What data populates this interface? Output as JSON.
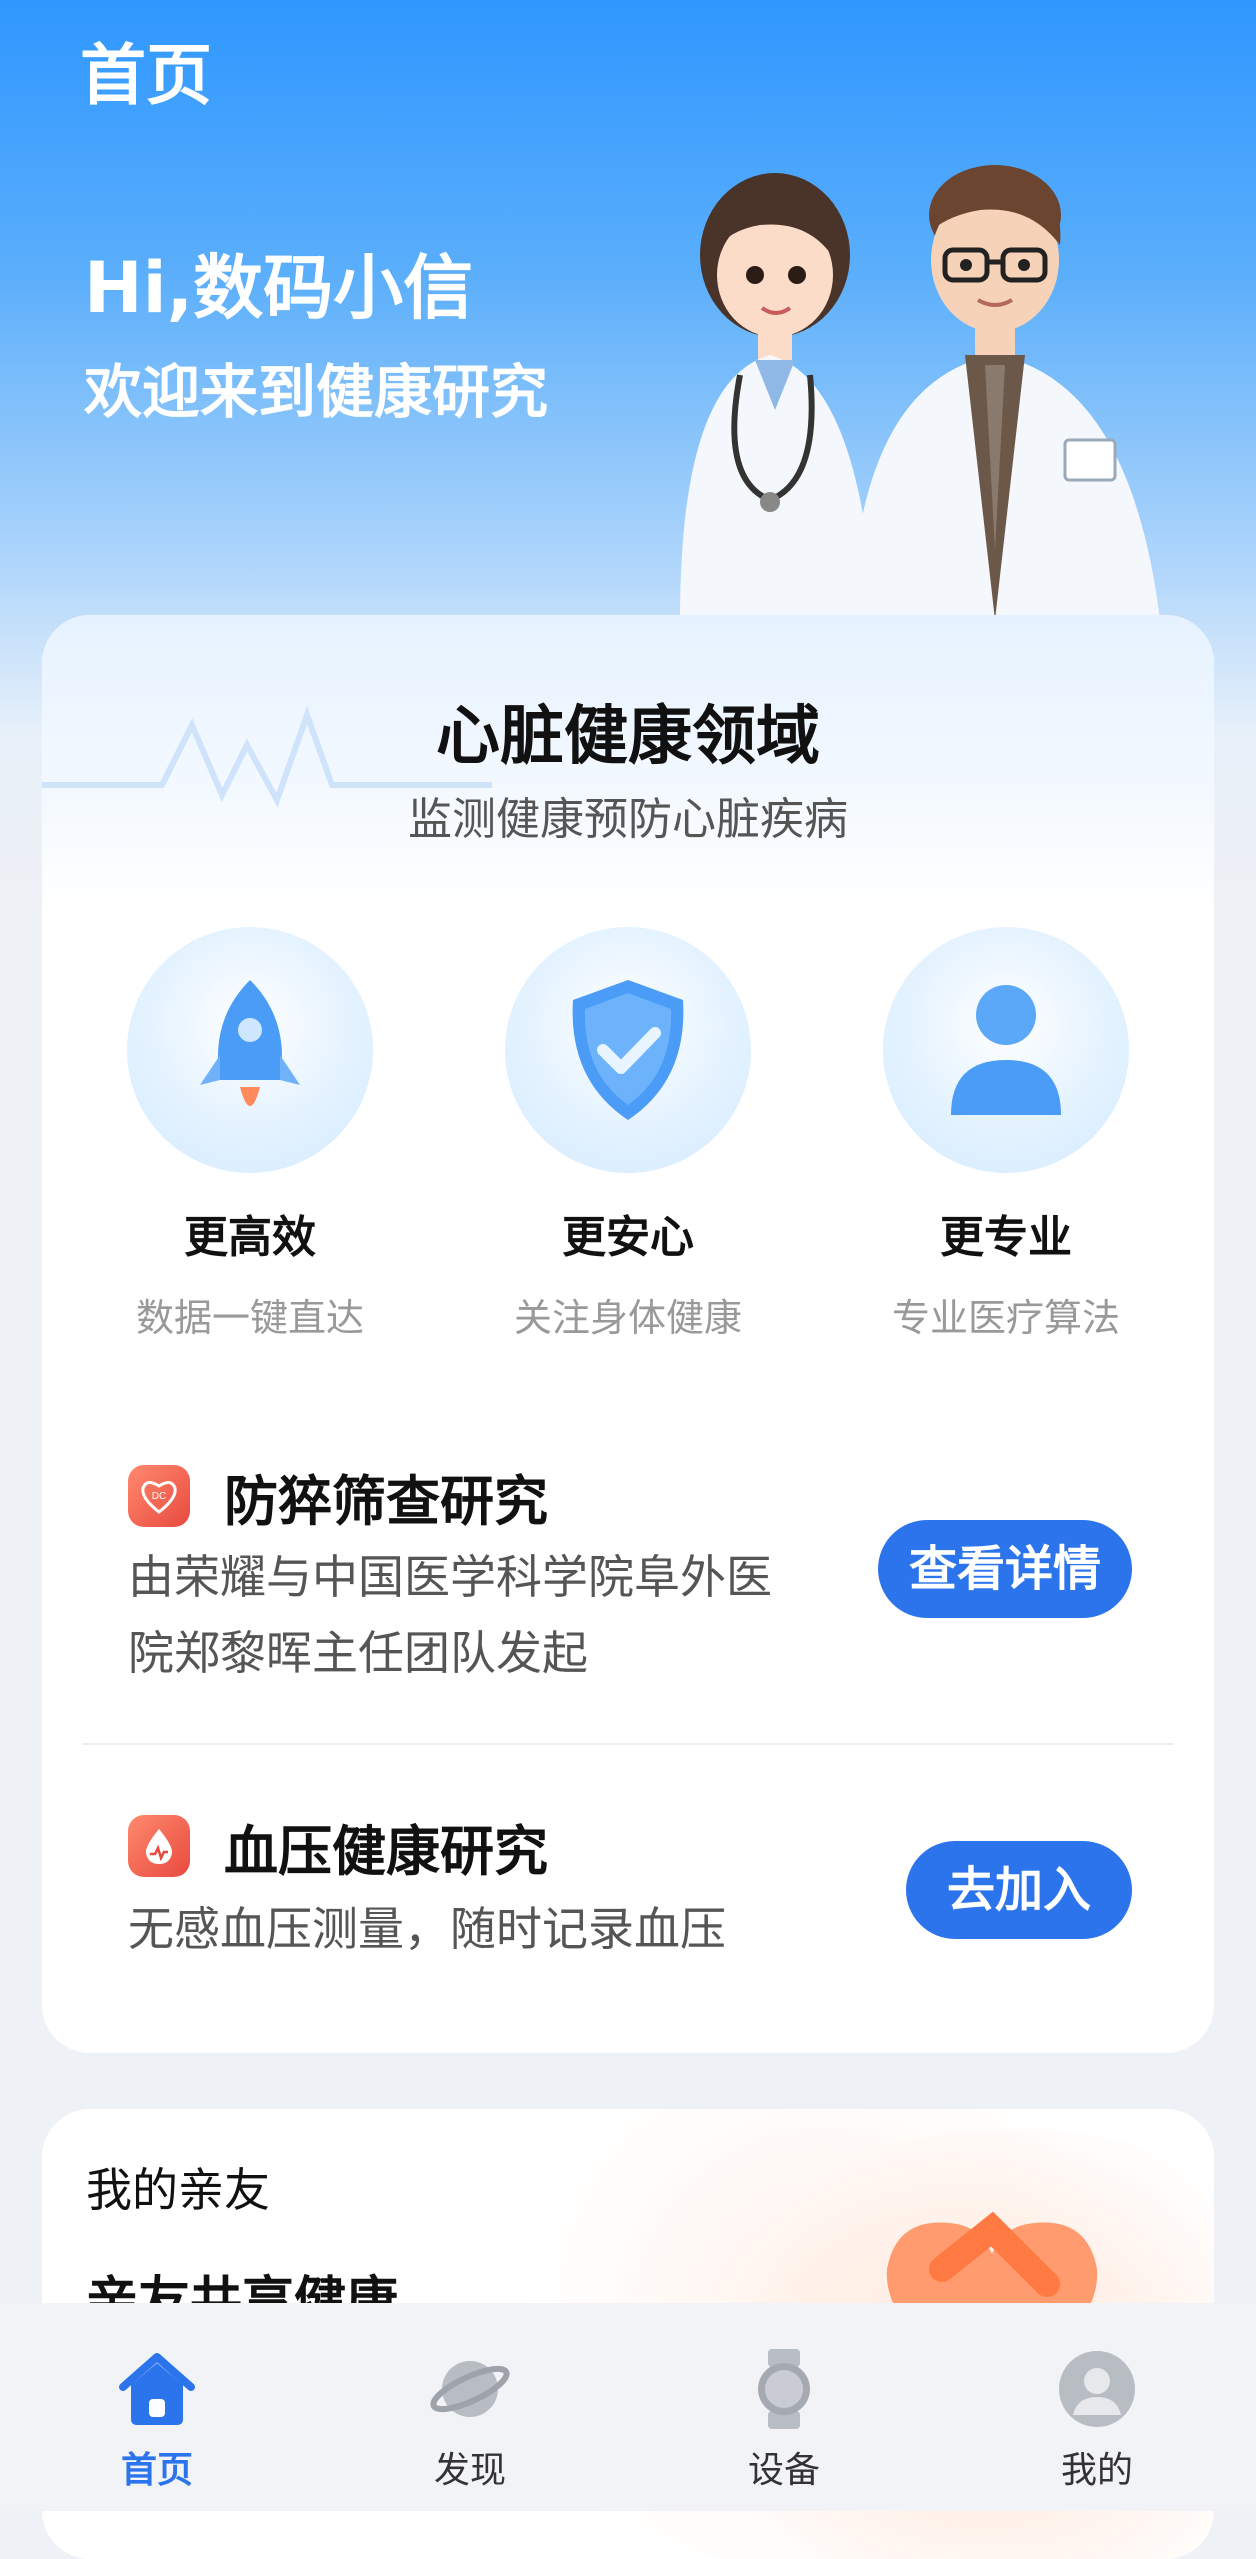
{
  "header": {
    "page_title": "首页",
    "greeting": "Hi,数码小信",
    "welcome": "欢迎来到健康研究"
  },
  "heart_domain": {
    "title": "心脏健康领域",
    "subtitle": "监测健康预防心脏疾病",
    "features": [
      {
        "title": "更高效",
        "desc": "数据一键直达",
        "icon": "rocket-icon"
      },
      {
        "title": "更安心",
        "desc": "关注身体健康",
        "icon": "shield-check-icon"
      },
      {
        "title": "更专业",
        "desc": "专业医疗算法",
        "icon": "person-icon"
      }
    ],
    "studies": [
      {
        "icon": "dc-heart-icon",
        "title": "防猝筛查研究",
        "desc_line1": "由荣耀与中国医学科学院阜外医",
        "desc_line2": "院郑黎晖主任团队发起",
        "button": "查看详情"
      },
      {
        "icon": "blood-drop-icon",
        "title": "血压健康研究",
        "desc_line1": "无感血压测量，随时记录血压",
        "button": "去加入"
      }
    ]
  },
  "friends": {
    "title": "我的亲友",
    "subtitle": "亲友共享健康"
  },
  "tabbar": {
    "tabs": [
      {
        "label": "首页",
        "icon": "home-icon",
        "active": true
      },
      {
        "label": "发现",
        "icon": "planet-icon",
        "active": false
      },
      {
        "label": "设备",
        "icon": "watch-icon",
        "active": false
      },
      {
        "label": "我的",
        "icon": "avatar-icon",
        "active": false
      }
    ]
  },
  "colors": {
    "accent": "#2b74ec",
    "hero_top": "#2f97ff",
    "study_icon": "#e8493f"
  }
}
